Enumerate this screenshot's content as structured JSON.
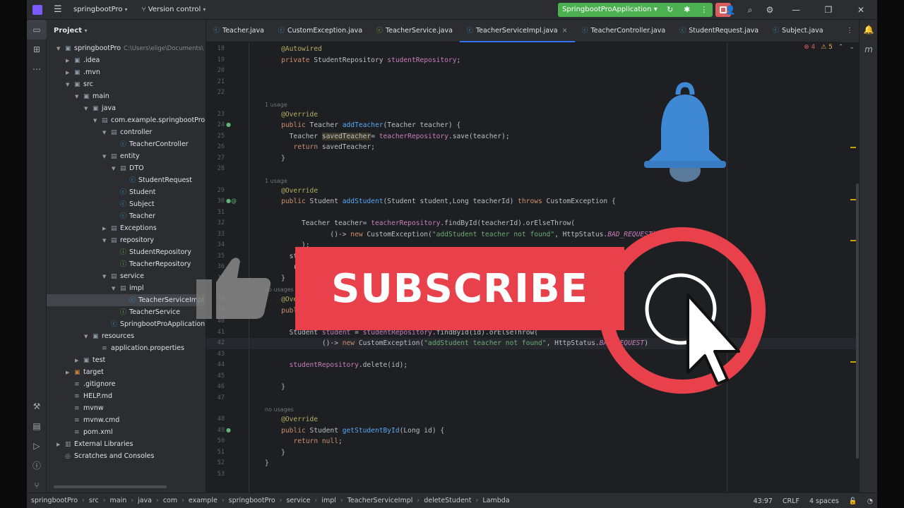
{
  "titlebar": {
    "project": "springbootPro",
    "version_control": "Version control",
    "run_config": "SpringbootProApplication"
  },
  "project_panel": {
    "title": "Project",
    "root_path": "C:\\Users\\elige\\Documents\\",
    "tree": [
      {
        "label": "springbootPro",
        "depth": 0,
        "type": "folder",
        "expanded": true
      },
      {
        "label": ".idea",
        "depth": 1,
        "type": "folder",
        "expanded": false
      },
      {
        "label": ".mvn",
        "depth": 1,
        "type": "folder",
        "expanded": false
      },
      {
        "label": "src",
        "depth": 1,
        "type": "folder",
        "expanded": true
      },
      {
        "label": "main",
        "depth": 2,
        "type": "folder",
        "expanded": true
      },
      {
        "label": "java",
        "depth": 3,
        "type": "folder",
        "expanded": true
      },
      {
        "label": "com.example.springbootPro",
        "depth": 4,
        "type": "package",
        "expanded": true
      },
      {
        "label": "controller",
        "depth": 5,
        "type": "package",
        "expanded": true
      },
      {
        "label": "TeacherController",
        "depth": 6,
        "type": "class"
      },
      {
        "label": "entity",
        "depth": 5,
        "type": "package",
        "expanded": true
      },
      {
        "label": "DTO",
        "depth": 6,
        "type": "package",
        "expanded": true
      },
      {
        "label": "StudentRequest",
        "depth": 7,
        "type": "class"
      },
      {
        "label": "Student",
        "depth": 6,
        "type": "class"
      },
      {
        "label": "Subject",
        "depth": 6,
        "type": "class"
      },
      {
        "label": "Teacher",
        "depth": 6,
        "type": "class"
      },
      {
        "label": "Exceptions",
        "depth": 5,
        "type": "package",
        "expanded": false
      },
      {
        "label": "repository",
        "depth": 5,
        "type": "package",
        "expanded": true
      },
      {
        "label": "StudentRepository",
        "depth": 6,
        "type": "interface"
      },
      {
        "label": "TeacherRepository",
        "depth": 6,
        "type": "interface"
      },
      {
        "label": "service",
        "depth": 5,
        "type": "package",
        "expanded": true
      },
      {
        "label": "impl",
        "depth": 6,
        "type": "package",
        "expanded": true
      },
      {
        "label": "TeacherServiceImpl",
        "depth": 7,
        "type": "class",
        "selected": true
      },
      {
        "label": "TeacherService",
        "depth": 6,
        "type": "interface"
      },
      {
        "label": "SpringbootProApplication",
        "depth": 5,
        "type": "class"
      },
      {
        "label": "resources",
        "depth": 3,
        "type": "folder",
        "expanded": true
      },
      {
        "label": "application.properties",
        "depth": 4,
        "type": "file"
      },
      {
        "label": "test",
        "depth": 2,
        "type": "folder",
        "expanded": false
      },
      {
        "label": "target",
        "depth": 1,
        "type": "folder-orange",
        "expanded": false
      },
      {
        "label": ".gitignore",
        "depth": 1,
        "type": "file"
      },
      {
        "label": "HELP.md",
        "depth": 1,
        "type": "file"
      },
      {
        "label": "mvnw",
        "depth": 1,
        "type": "file"
      },
      {
        "label": "mvnw.cmd",
        "depth": 1,
        "type": "file"
      },
      {
        "label": "pom.xml",
        "depth": 1,
        "type": "file"
      },
      {
        "label": "External Libraries",
        "depth": 0,
        "type": "lib",
        "expanded": false
      },
      {
        "label": "Scratches and Consoles",
        "depth": 0,
        "type": "scratch"
      }
    ]
  },
  "tabs": [
    {
      "label": "Teacher.java",
      "active": false
    },
    {
      "label": "CustomException.java",
      "active": false
    },
    {
      "label": "TeacherService.java",
      "active": false
    },
    {
      "label": "TeacherServiceImpl.java",
      "active": true
    },
    {
      "label": "TeacherController.java",
      "active": false
    },
    {
      "label": "StudentRequest.java",
      "active": false
    },
    {
      "label": "Subject.java",
      "active": false
    }
  ],
  "editor": {
    "errors": "4",
    "warnings": "5",
    "lines": [
      {
        "n": "18",
        "html": "    <span class='ann'>@Autowired</span>"
      },
      {
        "n": "19",
        "html": "    <span class='kw'>private</span> StudentRepository <span class='fld'>studentRepository</span>;"
      },
      {
        "n": "20",
        "html": ""
      },
      {
        "n": "21",
        "html": ""
      },
      {
        "n": "22",
        "html": ""
      },
      {
        "hint": "1 usage"
      },
      {
        "n": "23",
        "html": "    <span class='ann'>@Override</span>"
      },
      {
        "n": "24",
        "html": "    <span class='kw'>public</span> Teacher <span class='fn'>addTeacher</span>(Teacher teacher) {",
        "gicon": "●"
      },
      {
        "n": "25",
        "html": "      Teacher <span class='hl'>savedTeacher</span>= <span class='fld'>teacherRepository</span>.save(teacher);"
      },
      {
        "n": "26",
        "html": "       <span class='kw'>return</span> savedTeacher;"
      },
      {
        "n": "27",
        "html": "    }"
      },
      {
        "n": "28",
        "html": ""
      },
      {
        "hint": "1 usage"
      },
      {
        "n": "29",
        "html": "    <span class='ann'>@Override</span>"
      },
      {
        "n": "30",
        "html": "    <span class='kw'>public</span> Student <span class='fn'>addStudent</span>(Student student,Long teacherId) <span class='kw'>throws</span> CustomException {",
        "gicon": "●@"
      },
      {
        "n": "31",
        "html": ""
      },
      {
        "n": "32",
        "html": "         Teacher teacher= <span class='fld'>teacherRepository</span>.findById(teacherId).orElseThrow("
      },
      {
        "n": "33",
        "html": "                ()-> <span class='kw'>new</span> CustomException(<span class='str'>\"addStudent teacher not found\"</span>, HttpStatus.<span class='cst'>BAD_REQUEST</span>)"
      },
      {
        "n": "34",
        "html": "         );"
      },
      {
        "n": "35",
        "html": "      stud"
      },
      {
        "n": "36",
        "html": "       retu"
      },
      {
        "n": "37",
        "html": "    }"
      },
      {
        "hint": "no usages"
      },
      {
        "n": "38",
        "html": "    <span class='ann'>@Override</span>"
      },
      {
        "n": "39",
        "html": "    <span class='kw'>public</span> <span class='kw'>v</span>"
      },
      {
        "n": "40",
        "html": ""
      },
      {
        "n": "41",
        "html": "      Student <span class='fld'>student</span> = <span class='fld'>studentRepository</span>.findById(id).orElseThrow("
      },
      {
        "n": "42",
        "html": "              ()-> <span class='kw'>new</span> CustomException(<span class='str'>\"addStudent teacher not found\"</span>, HttpStatus.<span class='cst'>BAD_REQUEST</span>)",
        "current": true
      },
      {
        "n": "43",
        "html": ""
      },
      {
        "n": "44",
        "html": "      <span class='fld'>studentRepository</span>.delete(id);"
      },
      {
        "n": "45",
        "html": ""
      },
      {
        "n": "46",
        "html": "    }"
      },
      {
        "n": "47",
        "html": ""
      },
      {
        "hint": "no usages"
      },
      {
        "n": "48",
        "html": "    <span class='ann'>@Override</span>"
      },
      {
        "n": "49",
        "html": "    <span class='kw'>public</span> Student <span class='fn'>getStudentById</span>(Long id) {",
        "gicon": "●"
      },
      {
        "n": "50",
        "html": "       <span class='kw'>return</span> <span class='kw'>null</span>;"
      },
      {
        "n": "51",
        "html": "    }"
      },
      {
        "n": "52",
        "html": "}"
      },
      {
        "n": "53",
        "html": ""
      }
    ]
  },
  "statusbar": {
    "breadcrumb": [
      "springbootPro",
      "src",
      "main",
      "java",
      "com",
      "example",
      "springbootPro",
      "service",
      "impl",
      "TeacherServiceImpl",
      "deleteStudent",
      "Lambda"
    ],
    "position": "43:97",
    "line_ending": "CRLF",
    "indent": "4 spaces"
  },
  "overlay": {
    "subscribe_text": "SUBSCRIBE",
    "banner_color": "#e8414b"
  }
}
